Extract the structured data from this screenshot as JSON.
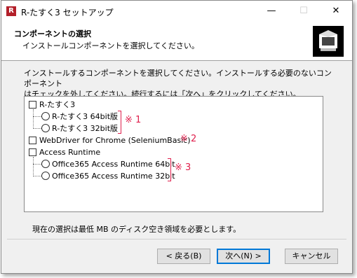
{
  "window": {
    "title": "R-たすく3 セットアップ",
    "minimize": "—",
    "maximize": "☐",
    "close": "✕"
  },
  "header": {
    "title": "コンポーネントの選択",
    "subtitle": "インストールコンポーネントを選択してください。",
    "logo_icon": "installer-box-icon"
  },
  "description": {
    "line1": "インストールするコンポーネントを選択してください。インストールする必要のないコンポーネント",
    "line2": "はチェックを外してください。続行するには「次へ」をクリックしてください。"
  },
  "tree": {
    "rtask": "R-たすく3",
    "rtask_64": "R-たすく3  64bit版",
    "rtask_32": "R-たすく3  32bit版",
    "webdriver": "WebDriver for Chrome (SeleniumBasic)",
    "access": "Access Runtime",
    "access_64": "Office365 Access Runtime 64bit",
    "access_32": "Office365 Access Runtime 32bit"
  },
  "notes": {
    "n1": "※ 1",
    "n2": "※ 2",
    "n3": "※ 3",
    "color": "#e0204d"
  },
  "space": {
    "text": "現在の選択は最低      MB のディスク空き領域を必要とします。"
  },
  "buttons": {
    "back": "< 戻る(B)",
    "next": "次へ(N) >",
    "cancel": "キャンセル"
  }
}
